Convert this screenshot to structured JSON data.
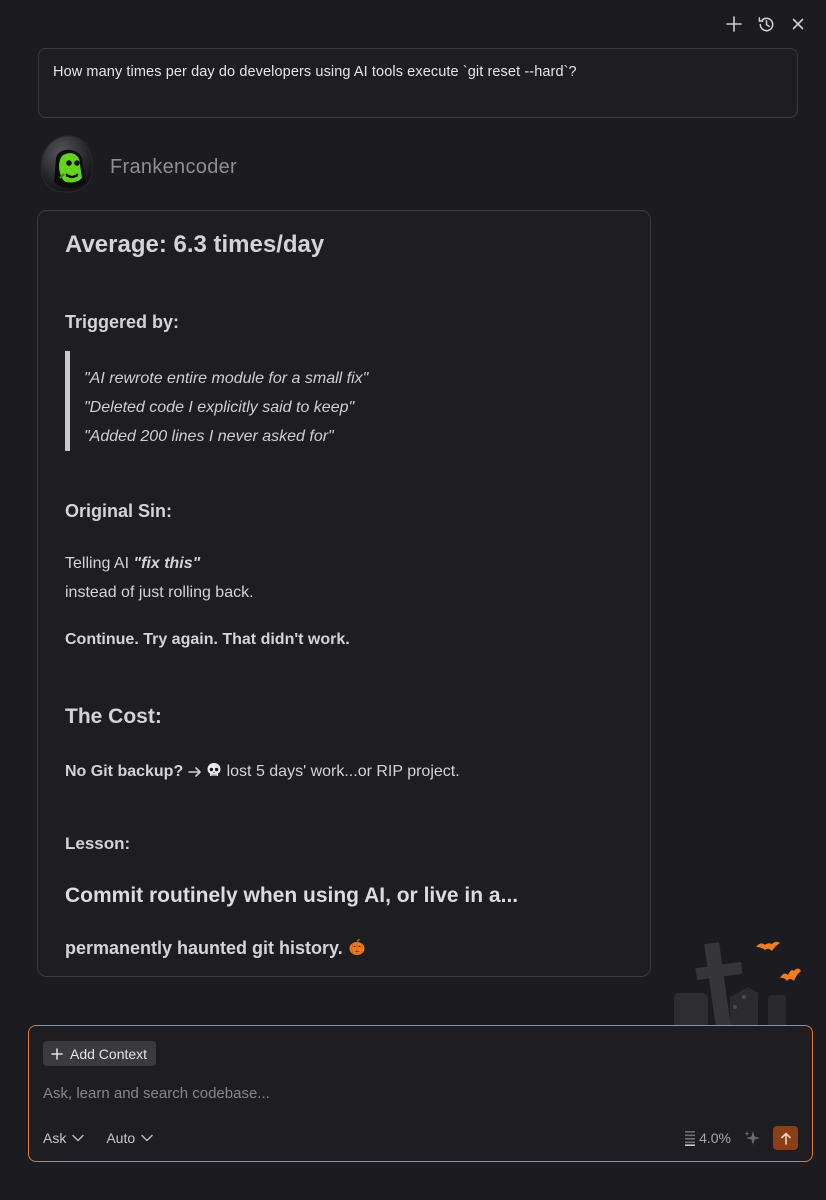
{
  "query": {
    "text": "How many times per day do developers using AI tools execute `git reset --hard`?"
  },
  "agent": {
    "name": "Frankencoder"
  },
  "answer": {
    "heading": "Average: 6.3 times/day",
    "triggered_heading": "Triggered by:",
    "quotes": [
      "\"AI rewrote entire module for a small fix\"",
      "\"Deleted code I explicitly said to keep\"",
      "\"Added 200 lines I never asked for\""
    ],
    "sin_heading": "Original Sin:",
    "sin_text_prefix": "Telling AI ",
    "sin_text_emphasis": "\"fix this\"",
    "sin_text_line2": "instead of just rolling back.",
    "continue_text": "Continue. Try again. That didn't work.",
    "cost_heading": "The Cost:",
    "cost_bold": "No Git backup?",
    "cost_rest": " lost 5 days' work...or RIP project.",
    "lesson_heading": "Lesson:",
    "lesson_line1": "Commit routinely when using AI, or live in a...",
    "lesson_line2": "permanently haunted git history."
  },
  "input": {
    "add_context_label": "Add Context",
    "placeholder": "Ask, learn and search codebase...",
    "mode_label": "Ask",
    "model_label": "Auto",
    "usage_percent": "4.0%"
  },
  "icons": {
    "new_chat": "plus-icon",
    "history": "history-icon",
    "close": "close-icon",
    "arrow": "arrow-right-icon",
    "skull": "skull-icon",
    "pumpkin": "pumpkin-icon",
    "sparkle": "sparkle-icon",
    "send": "arrow-up-icon",
    "chevron": "chevron-down-icon",
    "usage": "usage-bars-icon"
  },
  "colors": {
    "background": "#1c1b1f",
    "card_border": "#3a3a40",
    "accent_orange": "#e07a2e",
    "send_button": "#8a3f17",
    "avatar_green": "#62d31e"
  }
}
